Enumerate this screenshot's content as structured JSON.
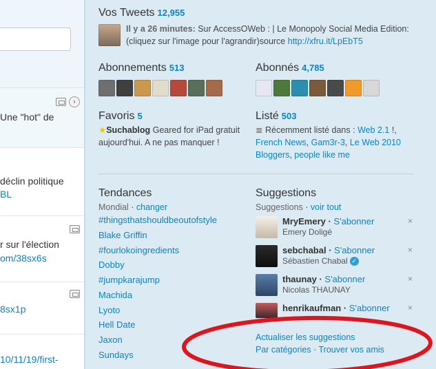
{
  "timeline": {
    "tweets": [
      {
        "text": "Une \"hot\" de",
        "link": ""
      },
      {
        "text": "déclin politique",
        "link": "BL"
      },
      {
        "text": "r sur l'élection",
        "link": "om/38sx6s"
      },
      {
        "text": "",
        "link": "8sx1p"
      },
      {
        "text": "",
        "link": "10/11/19/first-"
      }
    ]
  },
  "sidebar": {
    "tweets_section": {
      "title": "Vos Tweets",
      "count": "12,955",
      "time": "Il y a 26 minutes:",
      "text": "Sur AccessOWeb : | Le Monopoly Social Media Edition: (cliquez sur l'image pour l'agrandir)source",
      "link": "http://xfru.it/LpEbT5"
    },
    "following": {
      "title": "Abonnements",
      "count": "513"
    },
    "followers": {
      "title": "Abonnés",
      "count": "4,785"
    },
    "favorites": {
      "title": "Favoris",
      "count": "5",
      "user": "Suchablog",
      "text": "Geared for iPad gratuit aujourd'hui. A ne pas manquer !"
    },
    "listed": {
      "title": "Listé",
      "count": "503",
      "intro": "Récemment listé dans :",
      "lists": [
        "Web 2.1",
        "French News",
        "Gam3r-3",
        "Le Web 2010 Bloggers",
        "people like me"
      ]
    },
    "trends": {
      "title": "Tendances",
      "location": "Mondial",
      "change": "changer",
      "items": [
        "#thingsthatshouldbeoutofstyle",
        "Blake Griffin",
        "#fourlokoingredients",
        "Dobby",
        "#jumpkarajump",
        "Machida",
        "Lyoto",
        "Hell Date",
        "Jaxon",
        "Sundays"
      ]
    },
    "suggestions": {
      "title": "Suggestions",
      "subtitle": "Suggestions",
      "view_all": "voir tout",
      "follow_label": "S'abonner",
      "close": "×",
      "items": [
        {
          "handle": "MryEmery",
          "name": "Emery Doligé",
          "verified": false
        },
        {
          "handle": "sebchabal",
          "name": "Sébastien Chabal",
          "verified": true
        },
        {
          "handle": "thaunay",
          "name": "Nicolas THAUNAY",
          "verified": false
        },
        {
          "handle": "henrikaufman",
          "name": "",
          "verified": false
        }
      ],
      "refresh": "Actualiser les suggestions",
      "categories": "Par catégories",
      "find_friends": "Trouver vos amis"
    }
  },
  "colors": {
    "link": "#0a84c1",
    "sidebar_bg": "#dbeaf3",
    "annotation_ellipse": "#e0141c"
  }
}
